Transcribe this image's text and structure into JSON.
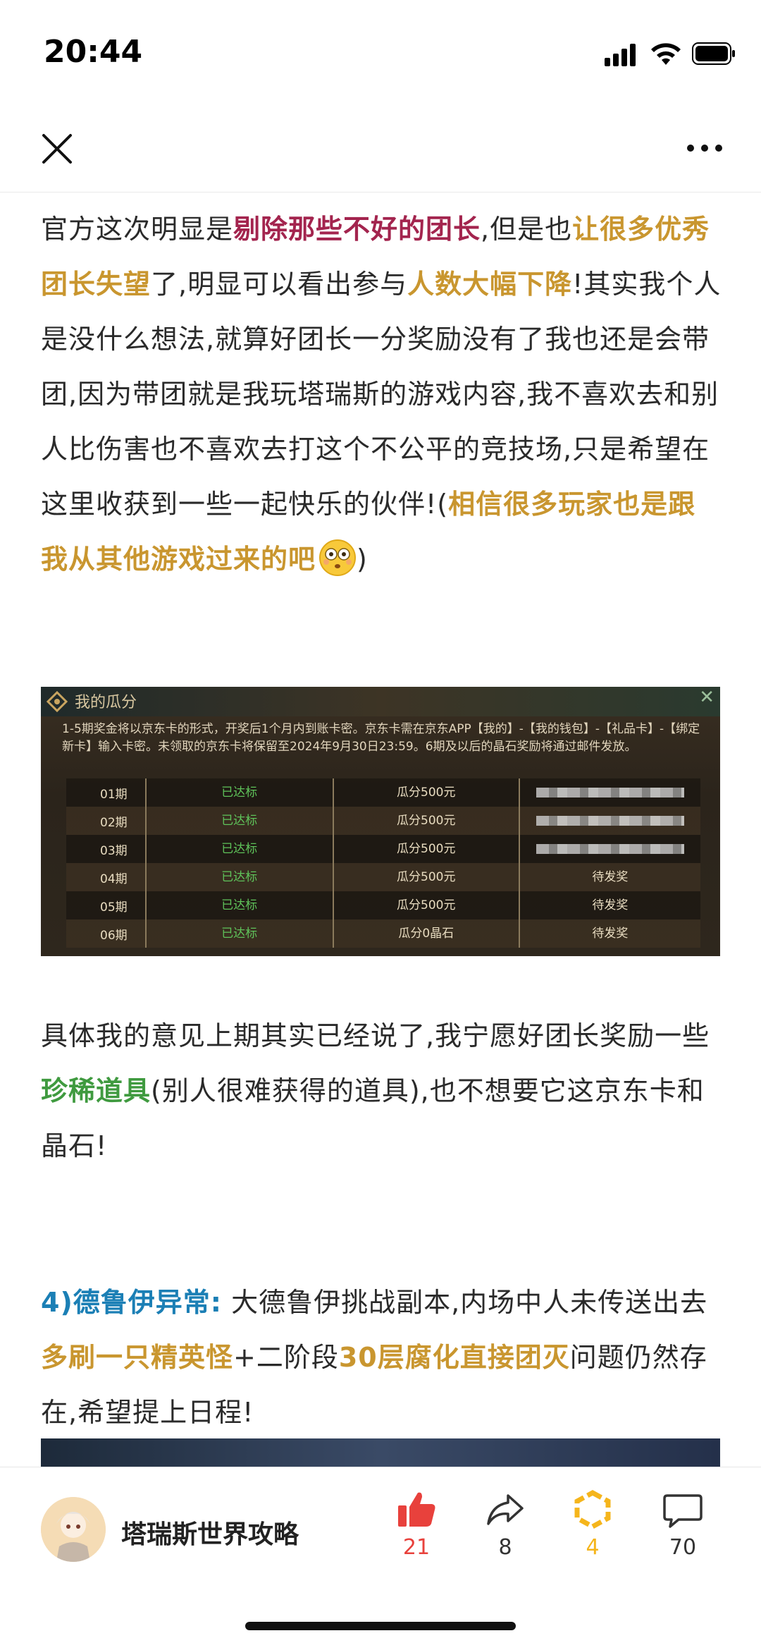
{
  "status_bar": {
    "time": "20:44"
  },
  "article": {
    "para1": [
      {
        "t": "官方这次明显是",
        "s": ""
      },
      {
        "t": "剔除那些不好的团长",
        "s": "red"
      },
      {
        "t": ",但是也",
        "s": ""
      },
      {
        "t": "让很多优秀团长失望",
        "s": "gold"
      },
      {
        "t": "了,明显可以看出参与",
        "s": ""
      },
      {
        "t": "人数大幅下降",
        "s": "gold"
      },
      {
        "t": "!其实我个人是没什么想法,就算好团长一分奖励没有了我也还是会带团,因为带团就是我玩塔瑞斯的游戏内容,我不喜欢去和别人比伤害也不喜欢去打这个不公平的竞技场,只是希望在这里收获到一些一起快乐的伙伴!(",
        "s": ""
      },
      {
        "t": "相信很多玩家也是跟我从其他游戏过来的吧",
        "s": "gold"
      }
    ],
    "para1_close": ")",
    "para2": [
      {
        "t": "具体我的意见上期其实已经说了,我宁愿好团长奖励一些",
        "s": ""
      },
      {
        "t": "珍稀道具",
        "s": "green"
      },
      {
        "t": "(别人很难获得的道具),也不想要它这京东卡和晶石!",
        "s": ""
      }
    ],
    "para3": [
      {
        "t": "4)德鲁伊异常:",
        "s": "blue"
      },
      {
        "t": " 大德鲁伊挑战副本,内场中人未传送出去",
        "s": ""
      },
      {
        "t": "多刷一只精英怪",
        "s": "gold"
      },
      {
        "t": "+二阶段",
        "s": ""
      },
      {
        "t": "30层腐化直接团灭",
        "s": "gold"
      },
      {
        "t": "问题仍然存在,希望提上日程!",
        "s": ""
      }
    ]
  },
  "screenshot": {
    "title": "我的瓜分",
    "notice": "1-5期奖金将以京东卡的形式，开奖后1个月内到账卡密。京东卡需在京东APP【我的】-【我的钱包】-【礼品卡】-【绑定新卡】输入卡密。未领取的京东卡将保留至2024年9月30日23:59。6期及以后的晶石奖励将通过邮件发放。",
    "rows": [
      {
        "period": "01期",
        "status": "已达标",
        "reward": "瓜分500元",
        "result": ""
      },
      {
        "period": "02期",
        "status": "已达标",
        "reward": "瓜分500元",
        "result": ""
      },
      {
        "period": "03期",
        "status": "已达标",
        "reward": "瓜分500元",
        "result": ""
      },
      {
        "period": "04期",
        "status": "已达标",
        "reward": "瓜分500元",
        "result": "待发奖"
      },
      {
        "period": "05期",
        "status": "已达标",
        "reward": "瓜分500元",
        "result": "待发奖"
      },
      {
        "period": "06期",
        "status": "已达标",
        "reward": "瓜分0晶石",
        "result": "待发奖"
      }
    ]
  },
  "footer": {
    "author": "塔瑞斯世界攻略",
    "like_count": "21",
    "share_count": "8",
    "collect_count": "4",
    "comment_count": "70",
    "like_color": "#e8413c",
    "collect_color": "#f5b51c"
  }
}
